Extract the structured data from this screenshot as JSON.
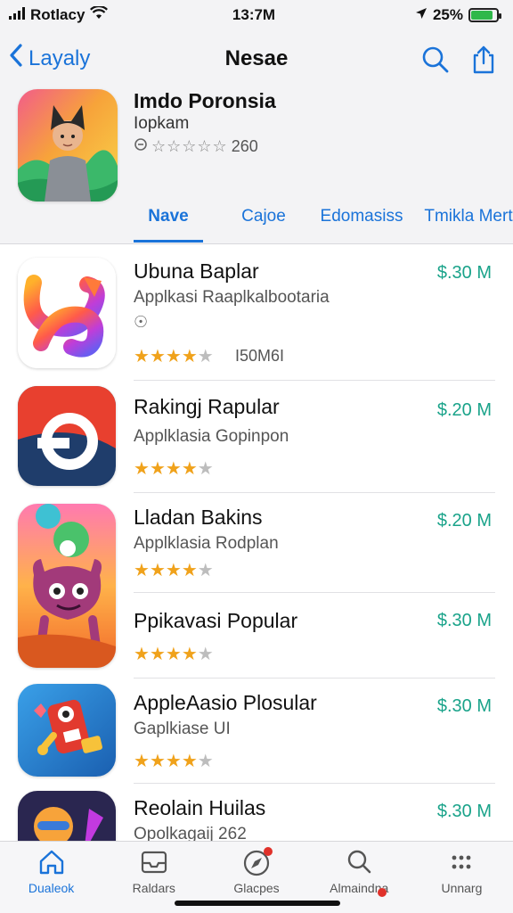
{
  "status": {
    "carrier": "Rotlacy",
    "time": "13:7M",
    "battery_text": "25%",
    "battery_level": 0.85,
    "colors": {
      "battery": "#2fb84a"
    }
  },
  "nav": {
    "back_label": "Layaly",
    "title": "Nesae",
    "icons": [
      "search-icon",
      "share-icon"
    ]
  },
  "hero": {
    "title": "Imdo Poronsia",
    "subtitle": "Iopkam",
    "rating_text": "260",
    "rating_stars": "☆☆☆☆☆"
  },
  "tabs": [
    {
      "label": "Nave",
      "active": true
    },
    {
      "label": "Cajoe",
      "active": false
    },
    {
      "label": "Edomasiss",
      "active": false
    },
    {
      "label": "Tmikla Mert",
      "active": false
    }
  ],
  "apps": [
    {
      "name": "Ubuna Baplar",
      "subtitle": "Applkasi Raaplkalbootaria",
      "price": "$.30 M",
      "rating": 4.5,
      "rating_count": "I50M6I",
      "extra": "☉"
    },
    {
      "name": "Rakingj Rapular",
      "subtitle": "Applklasia Gopinpon",
      "price": "$.20 M",
      "rating": 4.5,
      "rating_count": "",
      "extra": ""
    },
    {
      "name": "Lladan Bakins",
      "subtitle": "Applklasia Rodplan",
      "price": "$.20 M",
      "rating": 4.5,
      "rating_count": "",
      "extra": ""
    },
    {
      "name": "Ppikavasi Popular",
      "subtitle": "",
      "price": "$.30 M",
      "rating": 4.5,
      "rating_count": "",
      "extra": ""
    },
    {
      "name": "AppleAasio Plosular",
      "subtitle": "Gaplkiase UI",
      "price": "$.30 M",
      "rating": 4.5,
      "rating_count": "",
      "extra": ""
    },
    {
      "name": "Reolain Huilas",
      "subtitle": "Opolkagaij 262",
      "price": "$.30 M",
      "rating": 4.5,
      "rating_count": "",
      "extra": ""
    }
  ],
  "tabbar": [
    {
      "label": "Dualeok",
      "icon": "home-icon",
      "active": true
    },
    {
      "label": "Raldars",
      "icon": "tray-icon",
      "active": false
    },
    {
      "label": "Glacpes",
      "icon": "compass-icon",
      "active": false
    },
    {
      "label": "Almaindna",
      "icon": "search-icon",
      "active": false
    },
    {
      "label": "Unnarg",
      "icon": "grid-icon",
      "active": false
    }
  ],
  "colors": {
    "accent": "#1a73d9",
    "price": "#1aa38a",
    "star": "#f0a21b"
  }
}
